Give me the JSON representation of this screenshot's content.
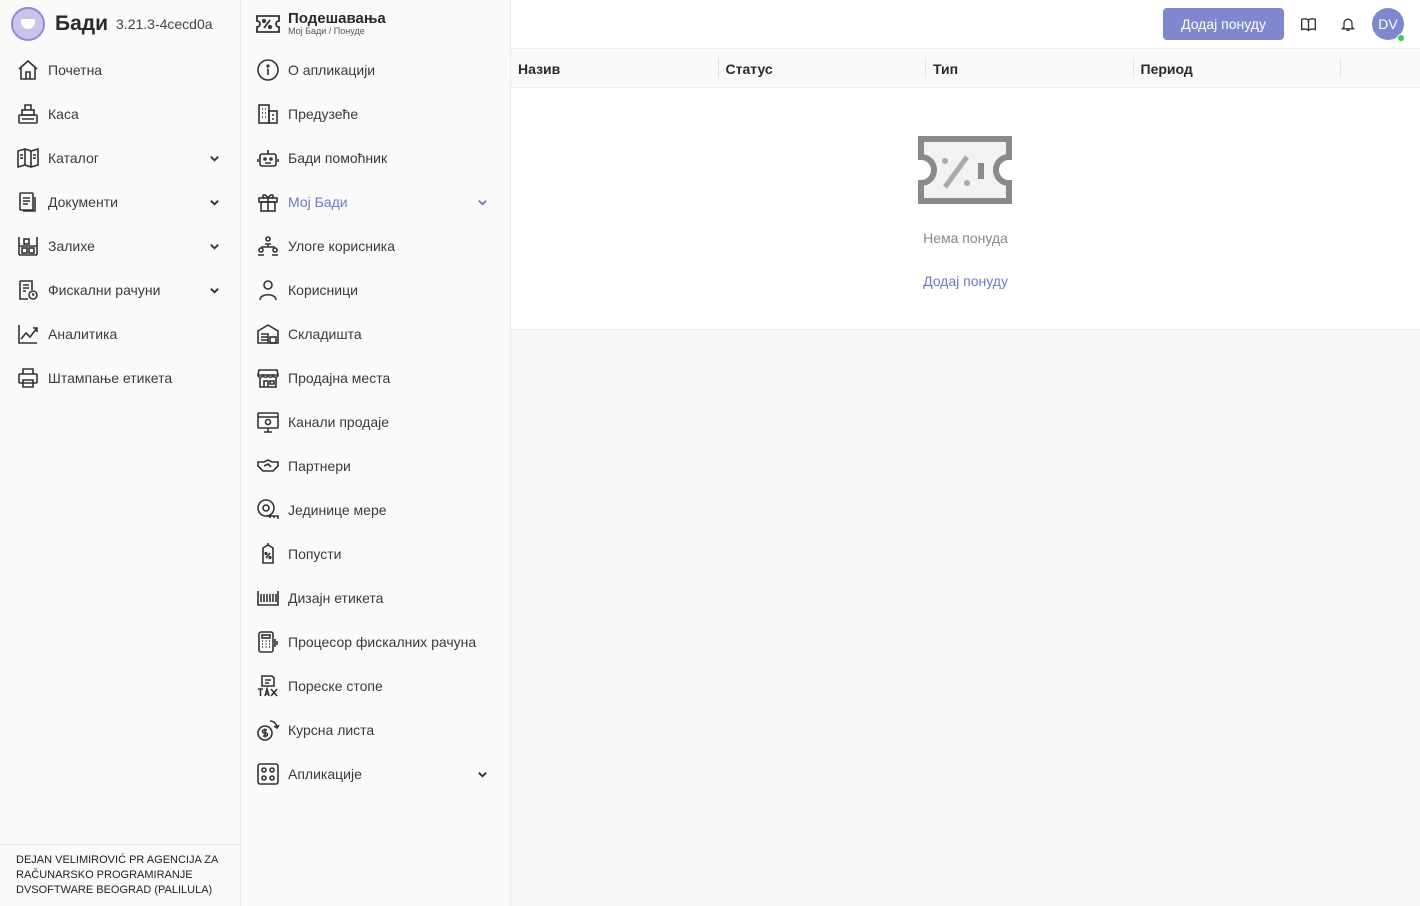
{
  "brand": {
    "name": "Бади",
    "version": "3.21.3-4cecd0a"
  },
  "sidebar": {
    "items": [
      {
        "label": "Почетна",
        "icon": "home-icon",
        "expandable": false
      },
      {
        "label": "Каса",
        "icon": "cash-register-icon",
        "expandable": false
      },
      {
        "label": "Каталог",
        "icon": "catalog-book-icon",
        "expandable": true
      },
      {
        "label": "Документи",
        "icon": "documents-icon",
        "expandable": true
      },
      {
        "label": "Залихе",
        "icon": "warehouse-shelf-icon",
        "expandable": true
      },
      {
        "label": "Фискални рачуни",
        "icon": "fiscal-receipt-icon",
        "expandable": true
      },
      {
        "label": "Аналитика",
        "icon": "analytics-chart-icon",
        "expandable": false
      },
      {
        "label": "Штампање етикета",
        "icon": "printer-icon",
        "expandable": false
      }
    ],
    "company": "DEJAN VELIMIROVIĆ PR AGENCIJA ZA RAČUNARSKO PROGRAMIRANJE DVSOFTWARE BEOGRAD (PALILULA)"
  },
  "settings": {
    "title": "Подешавања",
    "breadcrumb": "Мој Бади / Понуде",
    "items": [
      {
        "label": "О апликацији",
        "icon": "info-icon",
        "expandable": false
      },
      {
        "label": "Предузеће",
        "icon": "company-building-icon",
        "expandable": false
      },
      {
        "label": "Бади помоћник",
        "icon": "robot-assistant-icon",
        "expandable": false
      },
      {
        "label": "Мој Бади",
        "icon": "gift-box-icon",
        "expandable": true,
        "active": true
      },
      {
        "label": "Улоге корисника",
        "icon": "user-roles-icon",
        "expandable": false
      },
      {
        "label": "Корисници",
        "icon": "user-icon",
        "expandable": false
      },
      {
        "label": "Складишта",
        "icon": "warehouse-icon",
        "expandable": false
      },
      {
        "label": "Продајна места",
        "icon": "store-icon",
        "expandable": false
      },
      {
        "label": "Канали продаје",
        "icon": "sales-channel-icon",
        "expandable": false
      },
      {
        "label": "Партнери",
        "icon": "handshake-icon",
        "expandable": false
      },
      {
        "label": "Јединице мере",
        "icon": "measure-tape-icon",
        "expandable": false
      },
      {
        "label": "Попусти",
        "icon": "discount-tag-icon",
        "expandable": false
      },
      {
        "label": "Дизајн етикета",
        "icon": "barcode-icon",
        "expandable": false
      },
      {
        "label": "Процесор фискалних рачуна",
        "icon": "calculator-icon",
        "expandable": false
      },
      {
        "label": "Пореске стопе",
        "icon": "tax-icon",
        "expandable": false
      },
      {
        "label": "Курсна листа",
        "icon": "currency-exchange-icon",
        "expandable": false
      },
      {
        "label": "Апликације",
        "icon": "apps-grid-icon",
        "expandable": true
      }
    ]
  },
  "topbar": {
    "add_button": "Додај понуду",
    "avatar_initials": "DV"
  },
  "table": {
    "columns": [
      "Назив",
      "Статус",
      "Тип",
      "Период"
    ],
    "empty_text": "Нема понуда",
    "empty_action": "Додај понуду"
  },
  "colors": {
    "accent": "#7f88cf",
    "link": "#6f78c7",
    "online": "#3ec25b"
  }
}
